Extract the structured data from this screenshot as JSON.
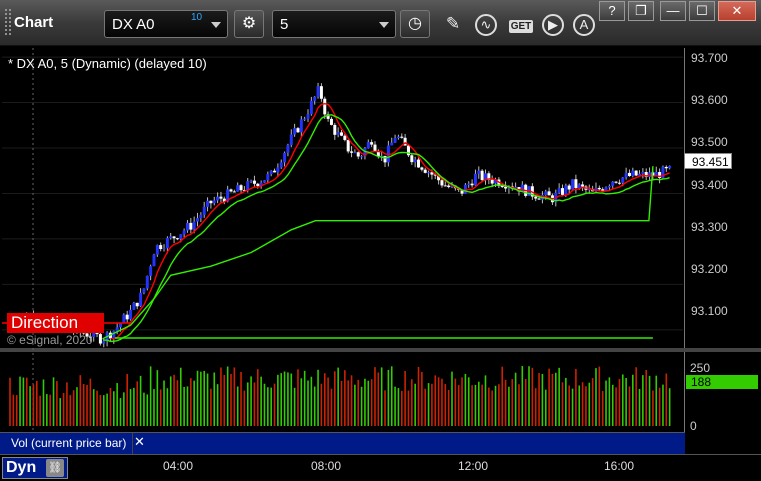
{
  "app": {
    "title": "Chart"
  },
  "toolbar": {
    "symbol": "DX A0",
    "delay": "10",
    "interval": "5",
    "get_label": "GET"
  },
  "window_controls": {
    "help": "?",
    "restore": "❐",
    "minimize": "—",
    "maximize": "☐",
    "close": "✕"
  },
  "chart": {
    "caption": "* DX A0, 5 (Dynamic) (delayed 10)",
    "study_label": "Direction",
    "copyright": "© eSignal, 2020",
    "last_price": "93.451",
    "price_ticks": [
      "93.700",
      "93.600",
      "93.500",
      "93.400",
      "93.300",
      "93.200",
      "93.100"
    ],
    "time_ticks": [
      "04:00",
      "08:00",
      "12:00",
      "16:00"
    ]
  },
  "volume": {
    "label": "Vol (current price bar)",
    "close": "✕",
    "ticks": [
      "250",
      "0"
    ],
    "current": "188"
  },
  "footer": {
    "tab_label": "Dyn"
  },
  "colors": {
    "bull": "#2233ff",
    "bear": "#ffffff",
    "red_line": "#ff0000",
    "green_line": "#33ee00",
    "vol_up": "#33cc00",
    "vol_down": "#cc2200"
  },
  "chart_data": {
    "type": "candlestick",
    "ylim": [
      93.06,
      93.72
    ],
    "x_hours": [
      1.0,
      17.5
    ],
    "price_path": [
      [
        1.0,
        93.12
      ],
      [
        1.5,
        93.13
      ],
      [
        2.0,
        93.11
      ],
      [
        2.5,
        93.1
      ],
      [
        3.0,
        93.09
      ],
      [
        3.3,
        93.08
      ],
      [
        3.6,
        93.1
      ],
      [
        4.0,
        93.14
      ],
      [
        4.3,
        93.18
      ],
      [
        4.6,
        93.28
      ],
      [
        5.0,
        93.3
      ],
      [
        5.5,
        93.33
      ],
      [
        6.0,
        93.38
      ],
      [
        6.5,
        93.4
      ],
      [
        7.0,
        93.42
      ],
      [
        7.5,
        93.44
      ],
      [
        8.0,
        93.52
      ],
      [
        8.4,
        93.58
      ],
      [
        8.7,
        93.63
      ],
      [
        8.9,
        93.56
      ],
      [
        9.4,
        93.5
      ],
      [
        9.7,
        93.48
      ],
      [
        10.0,
        93.52
      ],
      [
        10.3,
        93.47
      ],
      [
        10.6,
        93.53
      ],
      [
        11.0,
        93.48
      ],
      [
        11.4,
        93.45
      ],
      [
        11.8,
        93.42
      ],
      [
        12.2,
        93.4
      ],
      [
        12.6,
        93.44
      ],
      [
        13.0,
        93.43
      ],
      [
        13.5,
        93.42
      ],
      [
        14.0,
        93.4
      ],
      [
        14.5,
        93.39
      ],
      [
        15.0,
        93.42
      ],
      [
        15.5,
        93.4
      ],
      [
        16.0,
        93.43
      ],
      [
        16.5,
        93.44
      ],
      [
        17.0,
        93.44
      ],
      [
        17.4,
        93.45
      ]
    ],
    "green_steps": [
      [
        1.0,
        93.04
      ],
      [
        17.0,
        93.04
      ],
      [
        17.0,
        93.045
      ]
    ],
    "trail_line": [
      [
        3.3,
        93.08
      ],
      [
        4.0,
        93.11
      ],
      [
        4.6,
        93.17
      ],
      [
        5.0,
        93.22
      ],
      [
        6.0,
        93.24
      ],
      [
        7.0,
        93.27
      ],
      [
        8.0,
        93.32
      ],
      [
        8.6,
        93.34
      ],
      [
        9.0,
        93.34
      ],
      [
        12.0,
        93.34
      ],
      [
        15.0,
        93.34
      ],
      [
        16.9,
        93.34
      ],
      [
        17.0,
        93.46
      ]
    ]
  }
}
